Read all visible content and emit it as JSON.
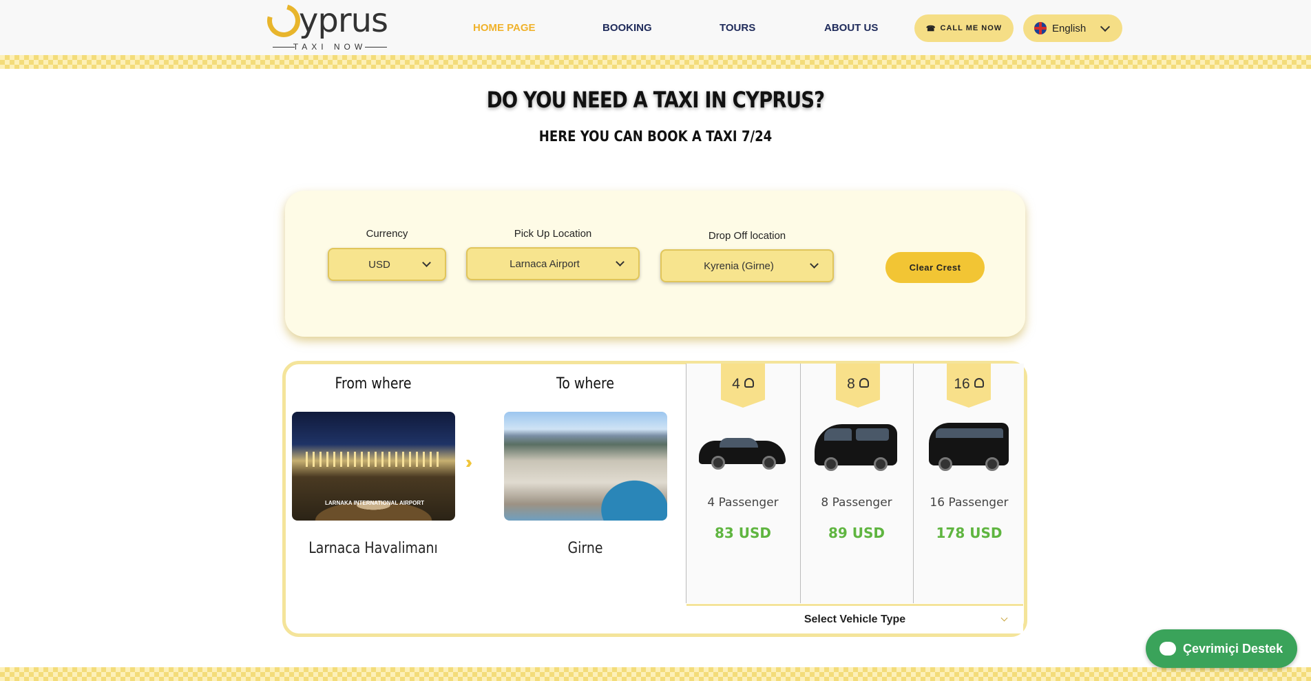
{
  "header": {
    "logo_word": "yprus",
    "logo_tagline": "TAXI NOW",
    "nav": [
      "HOME PAGE",
      "BOOKING",
      "TOURS",
      "ABOUT US"
    ],
    "call_button": "CALL ME NOW",
    "language": "English"
  },
  "hero": {
    "title": "DO YOU NEED A TAXI IN CYPRUS?",
    "subtitle": "HERE YOU CAN BOOK A TAXI 7/24"
  },
  "booking": {
    "currency_label": "Currency",
    "currency_value": "USD",
    "pickup_label": "Pick Up Location",
    "pickup_value": "Larnaca Airport",
    "dropoff_label": "Drop Off location",
    "dropoff_value": "Kyrenia (Girne)",
    "clear_button": "Clear Crest"
  },
  "route": {
    "from_heading": "From where",
    "to_heading": "To where",
    "from_place": "Larnaca Havalimanı",
    "to_place": "Girne",
    "airport_sign": "LARNAKA INTERNATIONAL AIRPORT",
    "arrow_glyph": "›››"
  },
  "vehicles": [
    {
      "capacity": "4",
      "label": "4 Passenger",
      "price": "83 USD"
    },
    {
      "capacity": "8",
      "label": "8 Passenger",
      "price": "89 USD"
    },
    {
      "capacity": "16",
      "label": "16 Passenger",
      "price": "178 USD"
    }
  ],
  "vehicle_select": "Select Vehicle Type",
  "chat": {
    "label": "Çevrimiçi Destek"
  },
  "colors": {
    "accent": "#f0b22b",
    "nav": "#1e2a5a",
    "price": "#5fb540",
    "chat": "#3aa35a"
  }
}
